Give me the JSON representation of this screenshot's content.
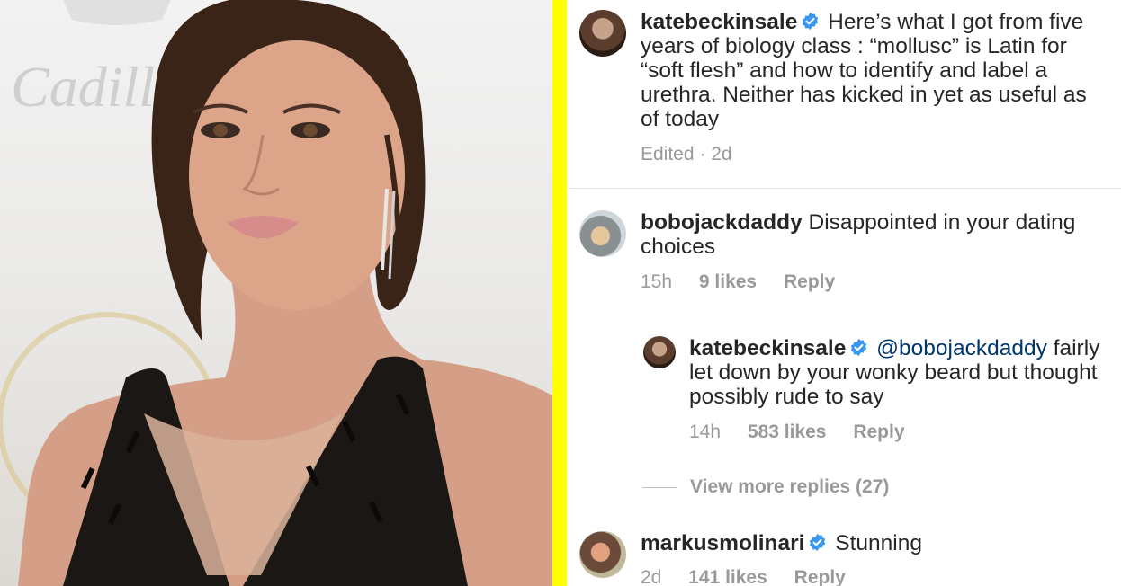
{
  "photo": {
    "logo_text": "Cadill"
  },
  "colors": {
    "divider": "#ffff00",
    "username": "#262626",
    "text": "#262626",
    "mention": "#003569",
    "meta": "#999999",
    "verified": "#3897f0"
  },
  "comments": [
    {
      "username": "katebeckinsale",
      "verified": true,
      "text": "Here’s what I got from five years of biology class : “mollusc” is Latin for “soft flesh” and how to identify and label a urethra. Neither has kicked in yet as useful as of today",
      "time": "Edited · 2d"
    },
    {
      "username": "bobojackdaddy",
      "verified": false,
      "text": "Disappointed in your dating choices",
      "time": "15h",
      "likes": "9 likes",
      "reply_label": "Reply"
    },
    {
      "username": "katebeckinsale",
      "verified": true,
      "mention": "@bobojackdaddy",
      "text": "fairly let down by your wonky beard but thought possibly rude to say",
      "time": "14h",
      "likes": "583 likes",
      "reply_label": "Reply"
    },
    {
      "username": "markusmolinari",
      "verified": true,
      "text": "Stunning",
      "time": "2d",
      "likes": "141 likes",
      "reply_label": "Reply"
    }
  ],
  "view_more_replies": "View more replies (27)",
  "icons": {
    "verified": "verified-badge-icon"
  }
}
